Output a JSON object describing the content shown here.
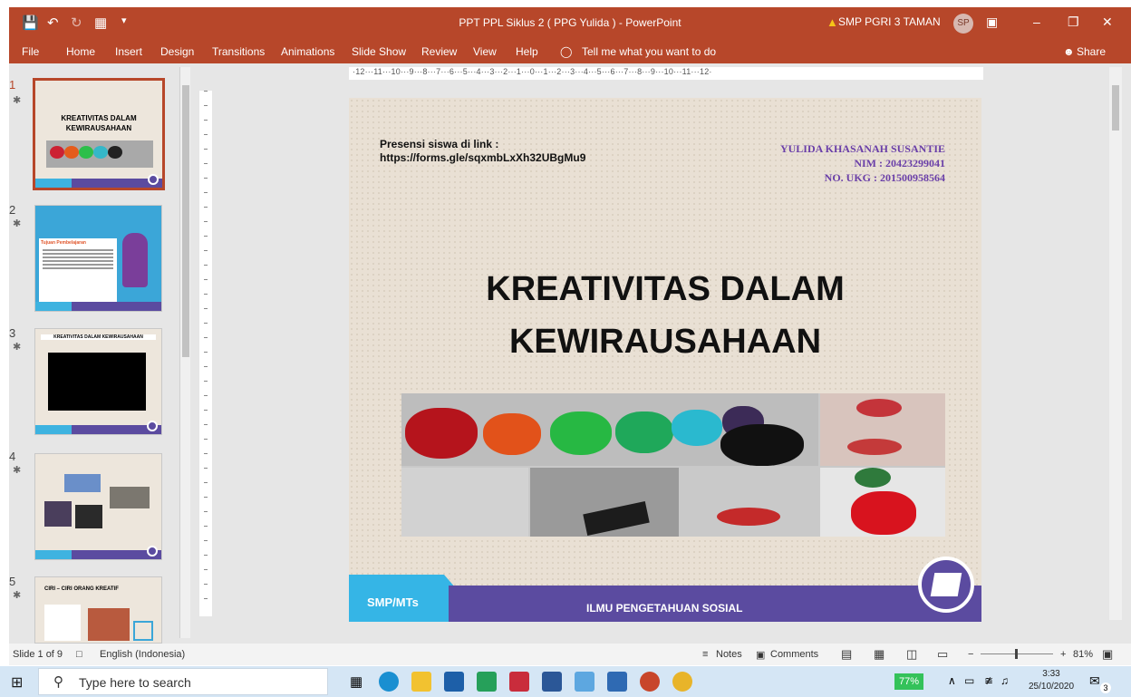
{
  "window": {
    "title": "PPT PPL Siklus 2 ( PPG Yulida ) - PowerPoint",
    "account": "SMP PGRI 3 TAMAN",
    "avatar_initials": "SP",
    "warning_icon": "warning-triangle-icon",
    "accent": "#b7472a"
  },
  "menu": {
    "items": [
      "File",
      "Home",
      "Insert",
      "Design",
      "Transitions",
      "Animations",
      "Slide Show",
      "Review",
      "View",
      "Help"
    ],
    "tell_me": "Tell me what you want to do",
    "share": "Share"
  },
  "ruler": {
    "h_marks": "·12···11···10···9···8···7···6···5···4···3···2···1···0···1···2···3···4···5···6···7···8···9···10···11···12·"
  },
  "thumbnails": [
    {
      "num": "1",
      "title": "KREATIVITAS DALAM KEWIRAUSAHAAN",
      "selected": true
    },
    {
      "num": "2",
      "title": "Tujuan Pembelajaran",
      "selected": false
    },
    {
      "num": "3",
      "title": "KREATIVITAS DALAM KEWIRAUSAHAAN",
      "selected": false
    },
    {
      "num": "4",
      "title": "",
      "selected": false
    },
    {
      "num": "5",
      "title": "CIRI – CIRI ORANG KREATIF",
      "selected": false
    }
  ],
  "slide": {
    "presensi_label": "Presensi siswa di link :",
    "presensi_link": "https://forms.gle/sqxmbLxXh32UBgMu9",
    "author_name": "YULIDA KHASANAH SUSANTIE",
    "author_nim": "NIM : 20423299041",
    "author_ukg": "NO. UKG : 201500958564",
    "title_line1": "KREATIVITAS DALAM",
    "title_line2": "KEWIRAUSAHAAN",
    "footer_left": "SMP/MTs",
    "footer_center": "ILMU PENGETAHUAN SOSIAL"
  },
  "status": {
    "slide_info": "Slide 1 of 9",
    "language": "English (Indonesia)",
    "notes": "Notes",
    "comments": "Comments",
    "zoom": "81%"
  },
  "taskbar": {
    "search_placeholder": "Type here to search",
    "battery": "77%",
    "time": "3:33",
    "date": "25/10/2020",
    "notification_count": "3"
  }
}
